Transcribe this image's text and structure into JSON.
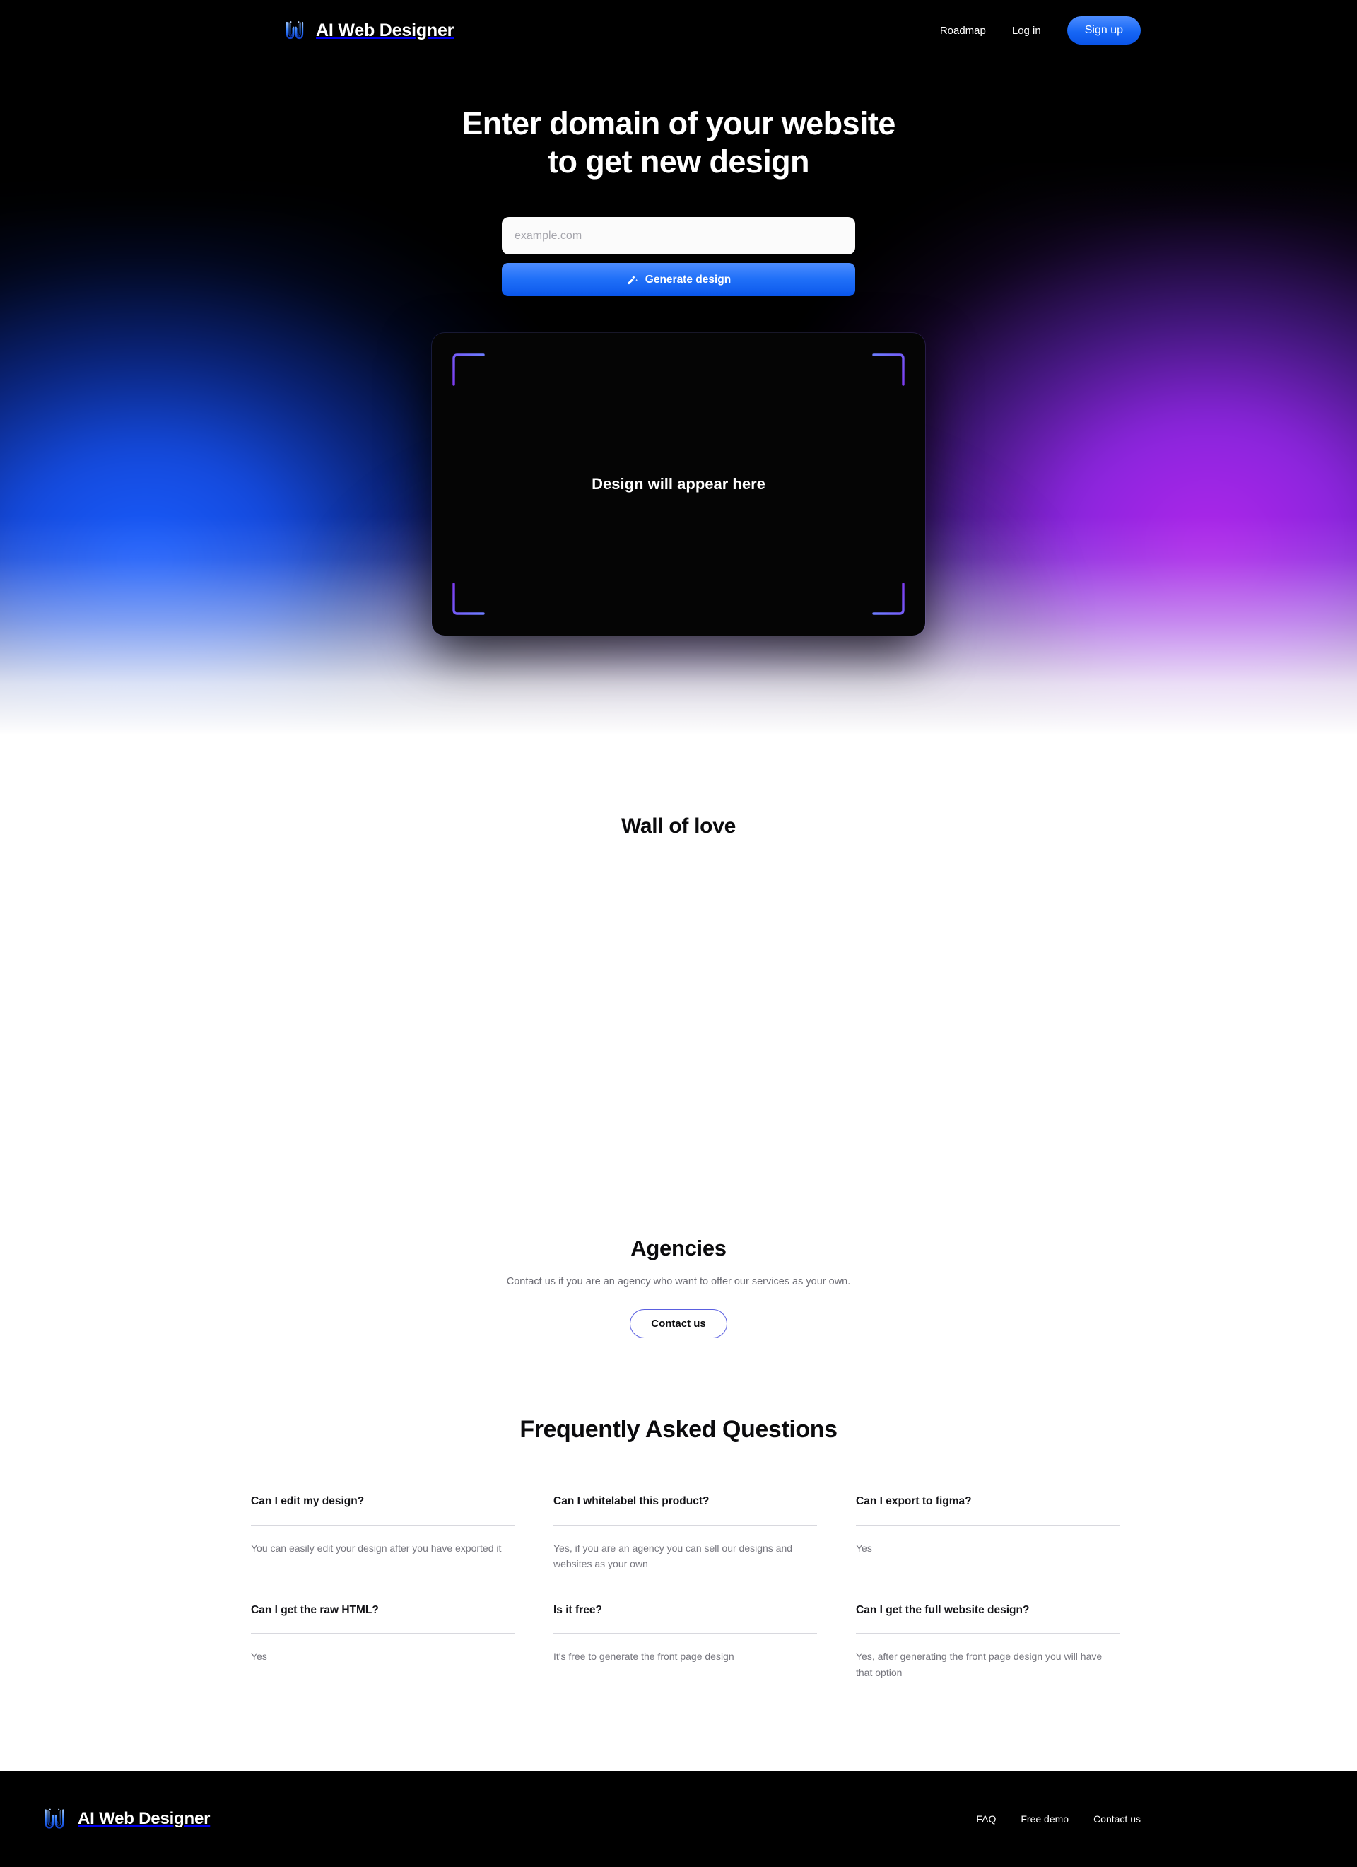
{
  "header": {
    "brand_name": "AI Web Designer",
    "logo_icon": "w-logo-icon",
    "nav": [
      {
        "label": "Roadmap"
      },
      {
        "label": "Log in"
      }
    ],
    "signup_label": "Sign up",
    "accent_color": "#1767f5"
  },
  "hero": {
    "title_line1": "Enter domain of your website",
    "title_line2": "to get new design",
    "input_placeholder": "example.com",
    "input_value": "",
    "generate_label": "Generate design",
    "generate_icon": "magic-wand-icon",
    "preview_placeholder": "Design will appear here",
    "corner_color": "#7c4dff",
    "gradient_blue": "#1a5eff",
    "gradient_purple": "#b026eb"
  },
  "wall": {
    "title": "Wall of love"
  },
  "agencies": {
    "title": "Agencies",
    "subtitle": "Contact us if you are an agency who want to offer our services as your own.",
    "button_label": "Contact us",
    "button_border_color": "#5a5fe0"
  },
  "faq": {
    "title": "Frequently Asked Questions",
    "items": [
      {
        "question": "Can I edit my design?",
        "answer": "You can easily edit your design after you have exported it"
      },
      {
        "question": "Can I whitelabel this product?",
        "answer": "Yes, if you are an agency you can sell our designs and websites as your own"
      },
      {
        "question": "Can I export to figma?",
        "answer": "Yes"
      },
      {
        "question": "Can I get the raw HTML?",
        "answer": "Yes"
      },
      {
        "question": "Is it free?",
        "answer": "It's free to generate the front page design"
      },
      {
        "question": "Can I get the full website design?",
        "answer": "Yes, after generating the front page design you will have that option"
      }
    ]
  },
  "footer": {
    "brand_name": "AI Web Designer",
    "logo_icon": "w-logo-icon",
    "links": [
      {
        "label": "FAQ"
      },
      {
        "label": "Free demo"
      },
      {
        "label": "Contact us"
      }
    ]
  }
}
